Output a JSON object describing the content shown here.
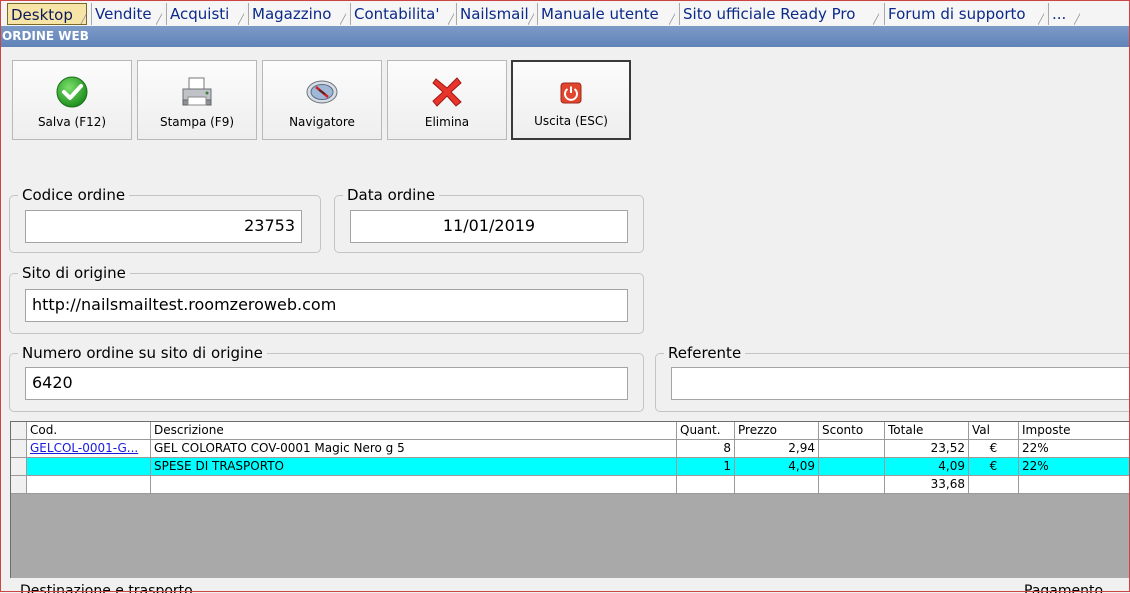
{
  "tabs": [
    {
      "label": "Desktop",
      "active": true
    },
    {
      "label": "Vendite"
    },
    {
      "label": "Acquisti"
    },
    {
      "label": "Magazzino"
    },
    {
      "label": "Contabilita'"
    },
    {
      "label": "Nailsmail"
    },
    {
      "label": "Manuale utente"
    },
    {
      "label": "Sito ufficiale Ready Pro"
    },
    {
      "label": "Forum di supporto"
    },
    {
      "label": "..."
    }
  ],
  "window": {
    "title": "ORDINE WEB"
  },
  "toolbar": {
    "save_label": "Salva (F12)",
    "print_label": "Stampa (F9)",
    "navigator_label": "Navigatore",
    "delete_label": "Elimina",
    "exit_label": "Uscita (ESC)"
  },
  "form": {
    "codice_ordine": {
      "label": "Codice ordine",
      "value": "23753"
    },
    "data_ordine": {
      "label": "Data ordine",
      "value": "11/01/2019"
    },
    "sito_origine": {
      "label": "Sito di origine",
      "value": "http://nailsmailtest.roomzeroweb.com"
    },
    "numero_ordine": {
      "label": "Numero ordine su sito di origine",
      "value": "6420"
    },
    "referente": {
      "label": "Referente",
      "value": ""
    }
  },
  "grid": {
    "columns": [
      "Cod.",
      "Descrizione",
      "Quant.",
      "Prezzo",
      "Sconto",
      "Totale",
      "Val",
      "Imposte"
    ],
    "rows": [
      {
        "cod": "GELCOL-0001-G...",
        "descrizione": "GEL COLORATO COV-0001 Magic Nero g 5",
        "quant": "8",
        "prezzo": "2,94",
        "sconto": "",
        "totale": "23,52",
        "val": "€",
        "imposte": "22%"
      },
      {
        "cod": "",
        "descrizione": "SPESE DI TRASPORTO",
        "quant": "1",
        "prezzo": "4,09",
        "sconto": "",
        "totale": "4,09",
        "val": "€",
        "imposte": "22%"
      }
    ],
    "total": "33,68"
  },
  "footer": {
    "left_label": "Destinazione e trasporto",
    "right_label": "Pagamento"
  },
  "colors": {
    "title_bar": "#5f82b8",
    "highlight_row": "#00ffff",
    "active_tab": "#f6e5a6",
    "tab_text": "#0b2a8a"
  }
}
